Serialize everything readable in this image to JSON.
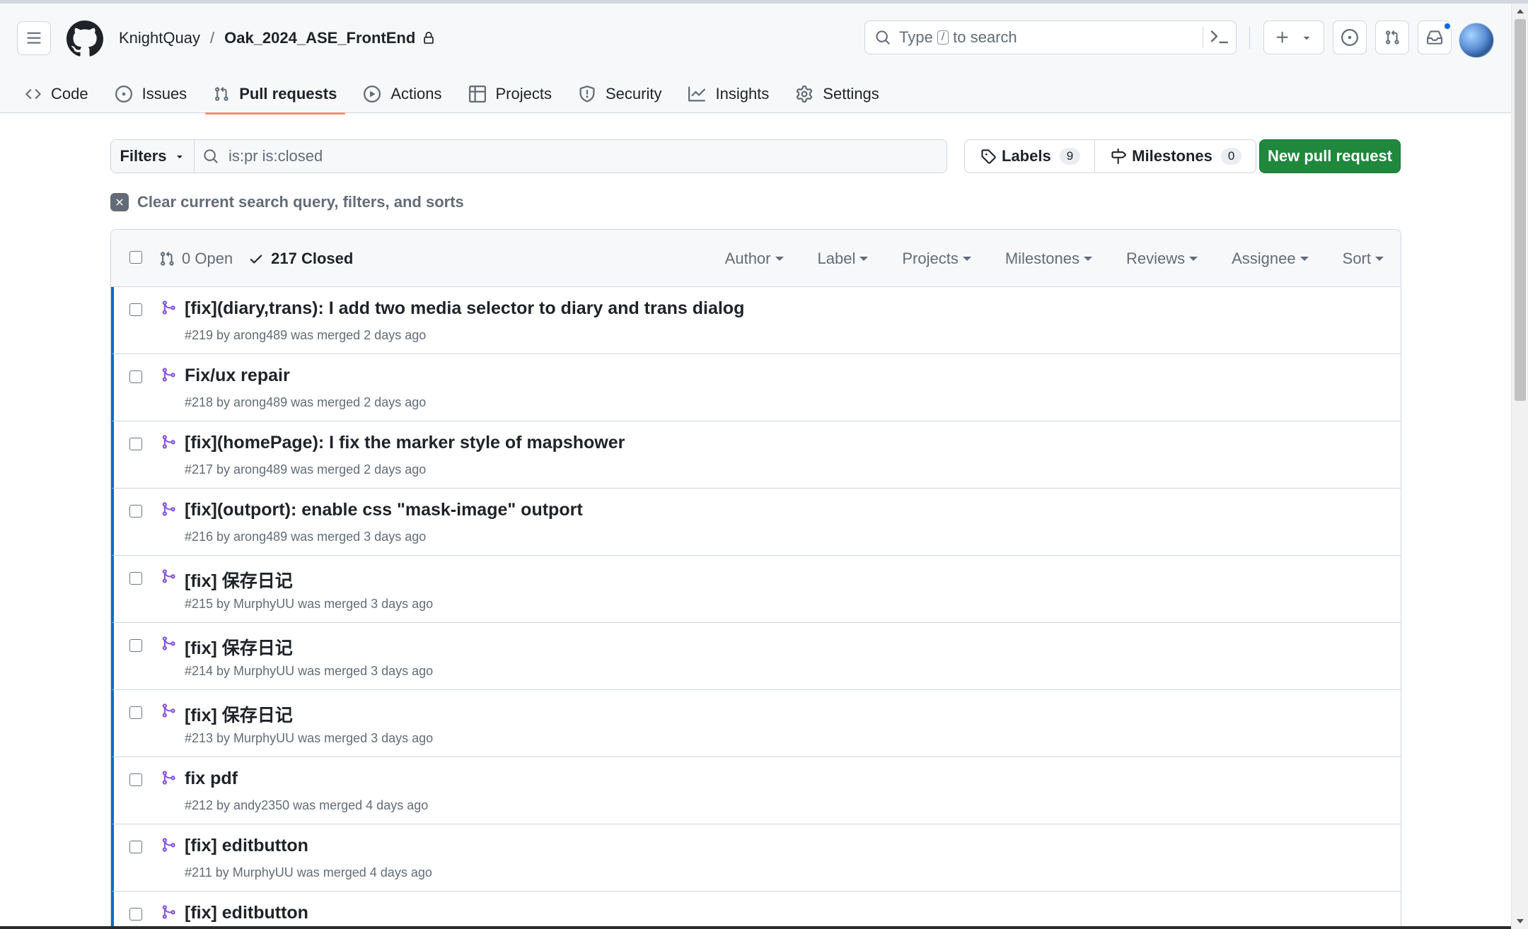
{
  "header": {
    "owner": "KnightQuay",
    "separator": "/",
    "repo": "Oak_2024_ASE_FrontEnd",
    "search": {
      "prefix": "Type",
      "key": "/",
      "suffix": "to search"
    }
  },
  "tabs": [
    {
      "label": "Code",
      "icon": "code-icon"
    },
    {
      "label": "Issues",
      "icon": "issue-opened-icon"
    },
    {
      "label": "Pull requests",
      "icon": "git-pull-request-icon",
      "active": true
    },
    {
      "label": "Actions",
      "icon": "play-icon"
    },
    {
      "label": "Projects",
      "icon": "table-icon"
    },
    {
      "label": "Security",
      "icon": "shield-icon"
    },
    {
      "label": "Insights",
      "icon": "graph-icon"
    },
    {
      "label": "Settings",
      "icon": "gear-icon"
    }
  ],
  "subnav": {
    "filters_label": "Filters",
    "query": "is:pr is:closed",
    "labels_label": "Labels",
    "labels_count": "9",
    "milestones_label": "Milestones",
    "milestones_count": "0",
    "new_pr_label": "New pull request",
    "clear_label": "Clear current search query, filters, and sorts"
  },
  "list_header": {
    "open_label": "0 Open",
    "closed_label": "217 Closed",
    "filters": [
      "Author",
      "Label",
      "Projects",
      "Milestones",
      "Reviews",
      "Assignee",
      "Sort"
    ]
  },
  "pulls": [
    {
      "title": "[fix](diary,trans): I add two media selector to diary and trans dialog",
      "meta": "#219 by arong489 was merged 2 days ago"
    },
    {
      "title": "Fix/ux repair",
      "meta": "#218 by arong489 was merged 2 days ago"
    },
    {
      "title": "[fix](homePage): I fix the marker style of mapshower",
      "meta": "#217 by arong489 was merged 2 days ago"
    },
    {
      "title": "[fix](outport): enable css \"mask-image\" outport",
      "meta": "#216 by arong489 was merged 3 days ago"
    },
    {
      "title": "[fix] 保存日记",
      "meta": "#215 by MurphyUU was merged 3 days ago"
    },
    {
      "title": "[fix] 保存日记",
      "meta": "#214 by MurphyUU was merged 3 days ago"
    },
    {
      "title": "[fix] 保存日记",
      "meta": "#213 by MurphyUU was merged 3 days ago"
    },
    {
      "title": "fix pdf",
      "meta": "#212 by andy2350 was merged 4 days ago"
    },
    {
      "title": "[fix] editbutton",
      "meta": "#211 by MurphyUU was merged 4 days ago"
    },
    {
      "title": "[fix] editbutton",
      "meta": ""
    }
  ],
  "colors": {
    "merged": "#8250df",
    "primary": "#1f883d",
    "accent_underline": "#fd8c73"
  }
}
